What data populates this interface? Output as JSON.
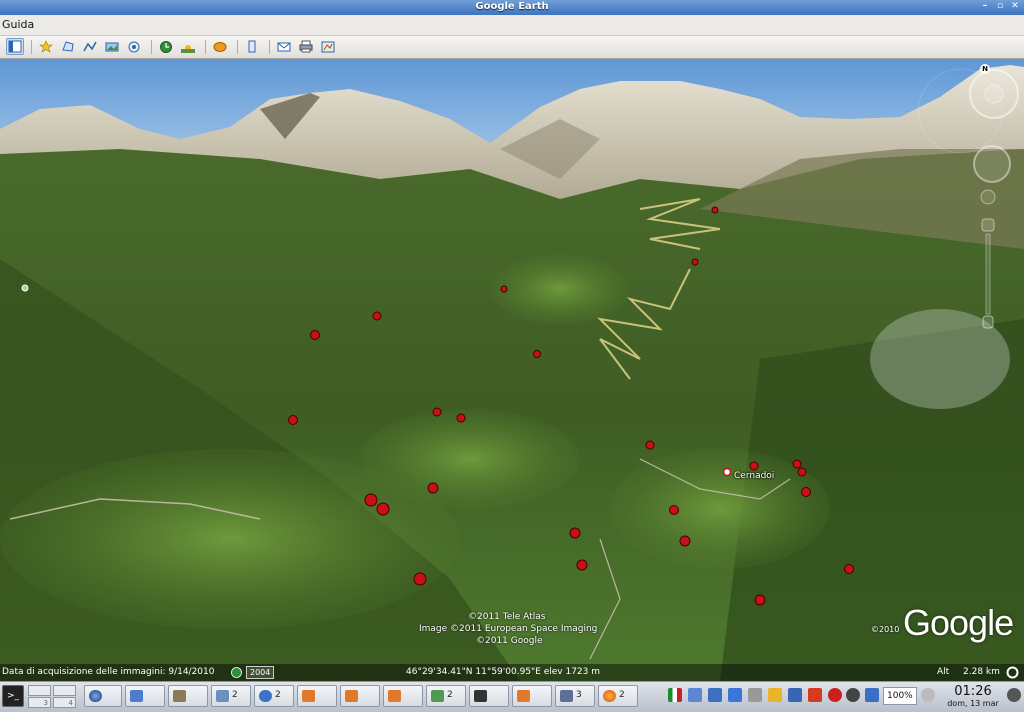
{
  "window": {
    "title": "Google Earth",
    "controls": [
      "minimize-icon",
      "maximize-icon",
      "close-icon"
    ]
  },
  "menu": {
    "items": [
      "Guida"
    ]
  },
  "toolbar": {
    "buttons": [
      "sidebar-icon",
      "placemark-icon",
      "polygon-icon",
      "path-icon",
      "image-overlay-icon",
      "record-tour-icon",
      "historical-imagery-icon",
      "sunlight-icon",
      "switch-sky-icon",
      "ruler-icon",
      "email-icon",
      "print-icon",
      "view-in-maps-icon"
    ]
  },
  "map": {
    "places": [
      {
        "label": "Cernadoi"
      }
    ],
    "credits": [
      "©2011 Tele Atlas",
      "Image ©2011 European Space Imaging",
      "©2011 Google"
    ],
    "logo": "Google",
    "logo_year": "©2010"
  },
  "status": {
    "imagery_date": "Data di acquisizione delle immagini: 9/14/2010",
    "year": "2004",
    "coordinates": "46°29'34.41\"N  11°59'00.95\"E  elev 1723 m",
    "altitude_label": "Alt",
    "altitude_value": "2.28 km"
  },
  "navigation": {
    "north": "N"
  },
  "taskbar": {
    "pager": [
      "3",
      "4"
    ],
    "task_counts": [
      "2",
      "2",
      "2",
      "3",
      "2"
    ],
    "zoom": "100%",
    "clock_time": "01:26",
    "clock_date": "dom, 13 mar"
  },
  "colors": {
    "titlebar": "#3e73c0",
    "sky": "#7fb0dd",
    "vegetation": "#4f6e2c",
    "marker": "#c8101a"
  }
}
